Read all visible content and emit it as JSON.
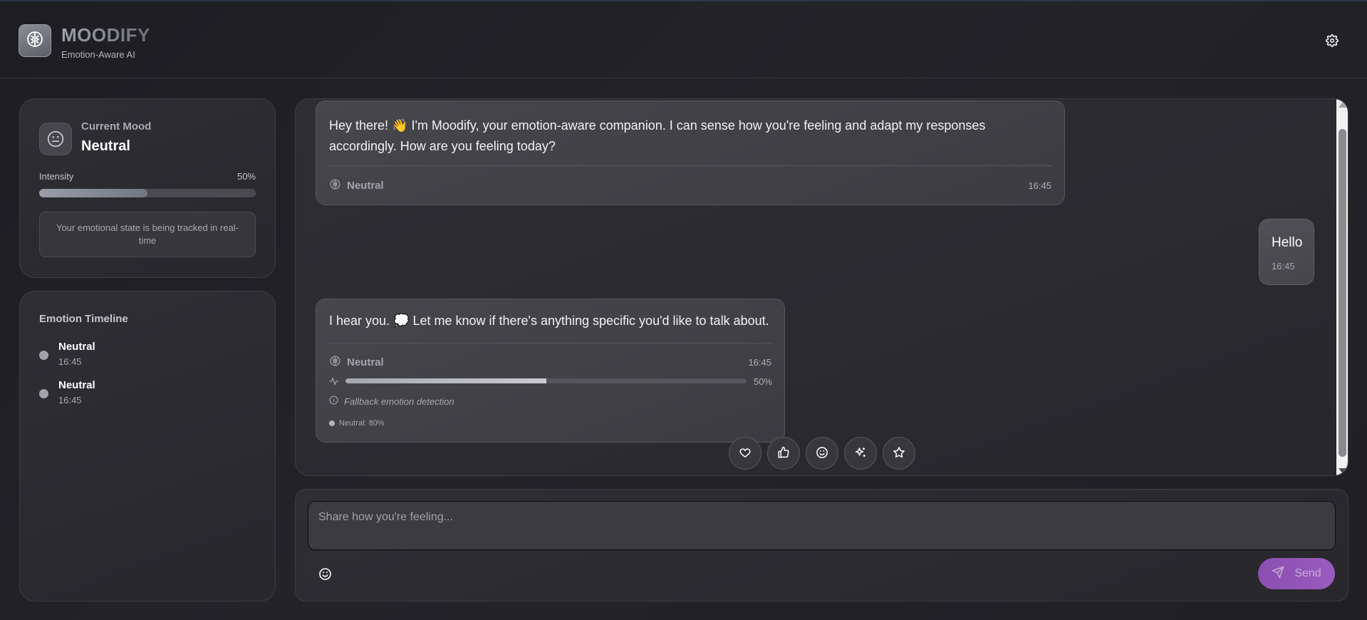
{
  "header": {
    "title": "MOODIFY",
    "subtitle": "Emotion-Aware AI",
    "logo_icon": "brain-icon",
    "settings_icon": "gear-icon"
  },
  "mood_card": {
    "label": "Current Mood",
    "value": "Neutral",
    "intensity_label": "Intensity",
    "intensity_value": "50%",
    "intensity_fraction": 0.5,
    "note": "Your emotional state is being tracked in real-time"
  },
  "timeline": {
    "title": "Emotion Timeline",
    "items": [
      {
        "emotion": "Neutral",
        "time": "16:45"
      },
      {
        "emotion": "Neutral",
        "time": "16:45"
      }
    ]
  },
  "messages": {
    "bot_1": {
      "text": "Hey there! 👋 I'm Moodify, your emotion-aware companion. I can sense how you're feeling and adapt my responses accordingly. How are you feeling today?",
      "emotion": "Neutral",
      "time": "16:45"
    },
    "user_1": {
      "text": "Hello",
      "time": "16:45"
    },
    "bot_2": {
      "text": "I hear you. 💭 Let me know if there's anything specific you'd like to talk about.",
      "emotion": "Neutral",
      "time": "16:45",
      "confidence_label": "50%",
      "confidence_fraction": 0.5,
      "fallback_note": "Fallback emotion detection",
      "distribution": "Neutral: 80%"
    }
  },
  "reactions": [
    "heart-icon",
    "thumbs-up-icon",
    "smile-icon",
    "sparkles-icon",
    "star-icon"
  ],
  "composer": {
    "placeholder": "Share how you're feeling...",
    "send_label": "Send"
  },
  "colors": {
    "background": "#202025",
    "panel": "#2b2b30",
    "bubble": "#414146",
    "accent_send": "#8e52b3"
  }
}
